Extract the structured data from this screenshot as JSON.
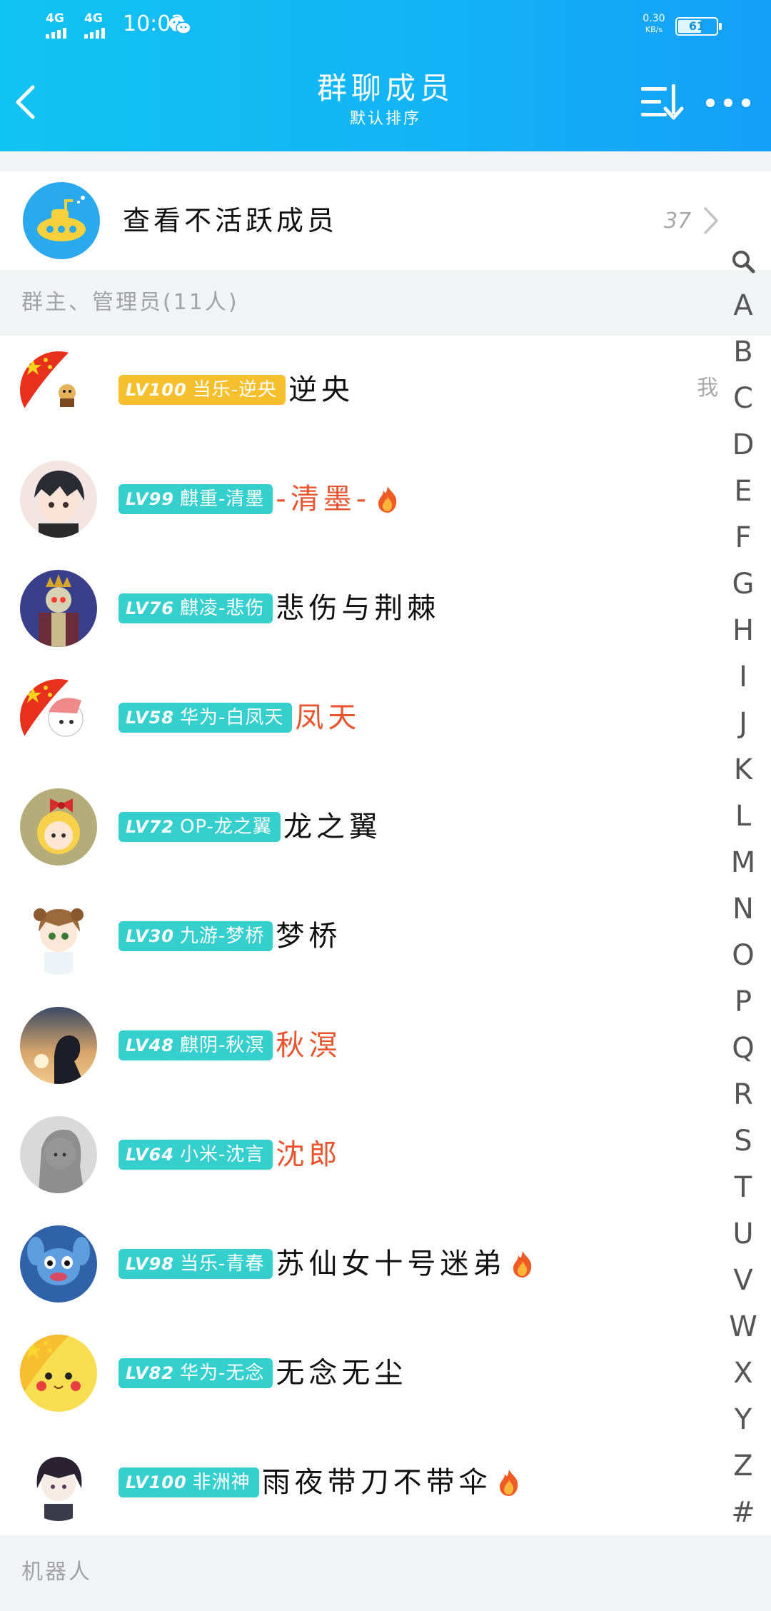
{
  "status_bar": {
    "sim1_label": "4G",
    "sim2_label": "4G",
    "time": "10:03",
    "net_speed_value": "0.30",
    "net_speed_unit": "KB/s",
    "battery_level": "61",
    "battery_fraction": 0.61
  },
  "header": {
    "title": "群聊成员",
    "subtitle": "默认排序",
    "icons": [
      "back-arrow-icon",
      "sort-icon",
      "more-icon"
    ]
  },
  "inactive": {
    "label": "查看不活跃成员",
    "count": "37"
  },
  "sections": {
    "admins": "群主、管理员(11人)",
    "robots": "机器人"
  },
  "members": [
    {
      "lv": "LV100",
      "title": "当乐-逆央",
      "nick": "逆央",
      "nick_color": "#111111",
      "badge_color": "#f6bf2c",
      "fire": false,
      "me": "我",
      "avatar": "flag-cat-avatar"
    },
    {
      "lv": "LV99",
      "title": "麒重-清墨",
      "nick": "-清墨-",
      "nick_color": "#e8542e",
      "badge_color": "#35cfcd",
      "fire": true,
      "me": "",
      "avatar": "boy-avatar"
    },
    {
      "lv": "LV76",
      "title": "麒凌-悲伤",
      "nick": "悲伤与荆棘",
      "nick_color": "#111111",
      "badge_color": "#35cfcd",
      "fire": false,
      "me": "",
      "avatar": "skeleton-king-avatar"
    },
    {
      "lv": "LV58",
      "title": "华为-白凤天",
      "nick": "凤天",
      "nick_color": "#e8542e",
      "badge_color": "#35cfcd",
      "fire": false,
      "me": "",
      "avatar": "flag-anime-avatar"
    },
    {
      "lv": "LV72",
      "title": "OP-龙之翼",
      "nick": "龙之翼",
      "nick_color": "#111111",
      "badge_color": "#35cfcd",
      "fire": false,
      "me": "",
      "avatar": "doll-avatar"
    },
    {
      "lv": "LV30",
      "title": "九游-梦桥",
      "nick": "梦桥",
      "nick_color": "#111111",
      "badge_color": "#35cfcd",
      "fire": false,
      "me": "",
      "avatar": "sakura-avatar"
    },
    {
      "lv": "LV48",
      "title": "麒阴-秋溟",
      "nick": "秋溟",
      "nick_color": "#e8542e",
      "badge_color": "#35cfcd",
      "fire": false,
      "me": "",
      "avatar": "sunset-avatar"
    },
    {
      "lv": "LV64",
      "title": "小米-沈言",
      "nick": "沈郎",
      "nick_color": "#e8542e",
      "badge_color": "#35cfcd",
      "fire": false,
      "me": "",
      "avatar": "grey-girl-avatar"
    },
    {
      "lv": "LV98",
      "title": "当乐-青春",
      "nick": "苏仙女十号迷弟",
      "nick_color": "#111111",
      "badge_color": "#35cfcd",
      "fire": true,
      "me": "",
      "avatar": "stitch-avatar"
    },
    {
      "lv": "LV82",
      "title": "华为-无念",
      "nick": "无念无尘",
      "nick_color": "#111111",
      "badge_color": "#35cfcd",
      "fire": false,
      "me": "",
      "avatar": "pikachu-avatar"
    },
    {
      "lv": "LV100",
      "title": "非洲神",
      "nick": "雨夜带刀不带伞",
      "nick_color": "#111111",
      "badge_color": "#35cfcd",
      "fire": true,
      "me": "",
      "avatar": "dark-hair-avatar"
    }
  ],
  "index_letters": [
    "A",
    "B",
    "C",
    "D",
    "E",
    "F",
    "G",
    "H",
    "I",
    "J",
    "K",
    "L",
    "M",
    "N",
    "O",
    "P",
    "Q",
    "R",
    "S",
    "T",
    "U",
    "V",
    "W",
    "X",
    "Y",
    "Z",
    "#"
  ]
}
